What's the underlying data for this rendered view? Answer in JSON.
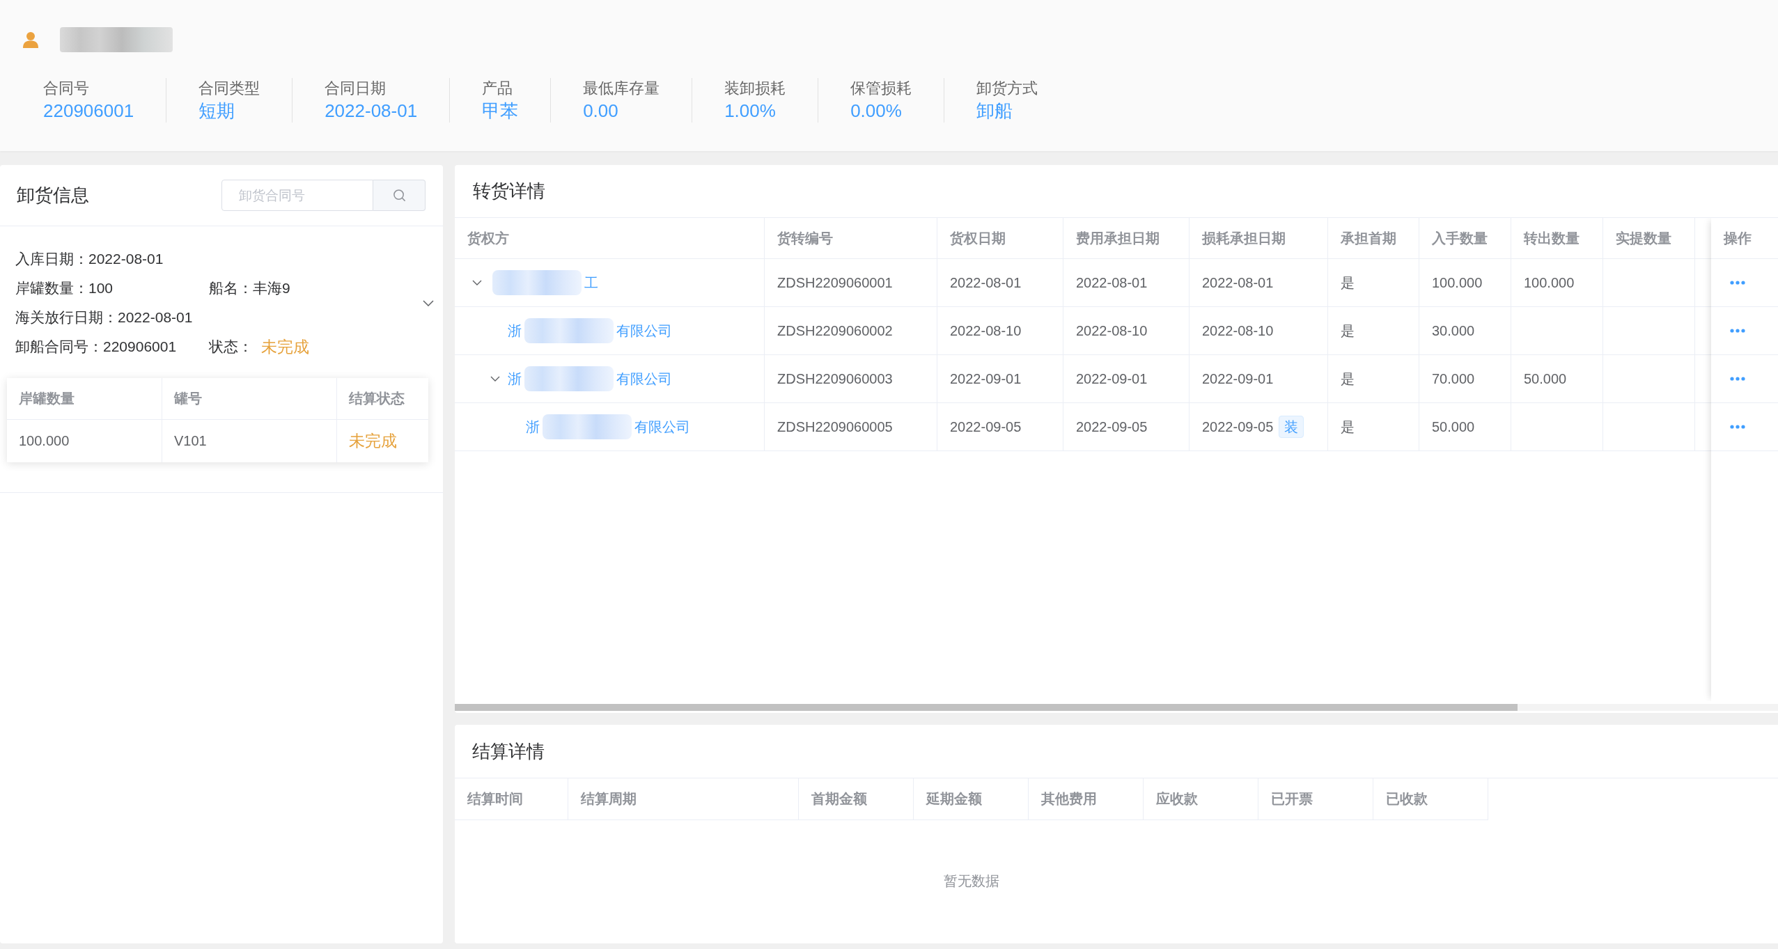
{
  "contract": {
    "fields": [
      {
        "label": "合同号",
        "value": "220906001"
      },
      {
        "label": "合同类型",
        "value": "短期"
      },
      {
        "label": "合同日期",
        "value": "2022-08-01"
      },
      {
        "label": "产品",
        "value": "甲苯"
      },
      {
        "label": "最低库存量",
        "value": "0.00"
      },
      {
        "label": "装卸损耗",
        "value": "1.00%"
      },
      {
        "label": "保管损耗",
        "value": "0.00%"
      },
      {
        "label": "卸货方式",
        "value": "卸船"
      }
    ]
  },
  "unload": {
    "title": "卸货信息",
    "search": {
      "placeholder": "卸货合同号"
    },
    "info_rows": [
      {
        "fields": [
          {
            "kind": "text",
            "label": "入库日期：",
            "value": "2022-08-01"
          }
        ]
      },
      {
        "fields": [
          {
            "kind": "text",
            "label": "岸罐数量：",
            "value": "100"
          },
          {
            "kind": "text",
            "label": "船名：",
            "value": "丰海9"
          }
        ]
      },
      {
        "fields": [
          {
            "kind": "text",
            "label": "海关放行日期：",
            "value": "2022-08-01"
          }
        ]
      },
      {
        "fields": [
          {
            "kind": "text",
            "label": "卸船合同号：",
            "value": "220906001"
          },
          {
            "kind": "status",
            "label": "状态：",
            "value": "未完成",
            "completed": false
          }
        ]
      }
    ],
    "tank_table": {
      "columns": [
        "岸罐数量",
        "罐号",
        "结算状态"
      ],
      "rows": [
        {
          "quantity": "100.000",
          "tank_no": "V101",
          "status": "未完成",
          "completed": false
        }
      ]
    }
  },
  "transfer": {
    "title": "转货详情",
    "columns": [
      "货权方",
      "货转编号",
      "货权日期",
      "费用承担日期",
      "损耗承担日期",
      "承担首期",
      "入手数量",
      "转出数量",
      "实提数量"
    ],
    "action_column": "操作",
    "rows": [
      {
        "owner_suffix": "工",
        "transfer_no": "ZDSH2209060001",
        "owner_date": "2022-08-01",
        "fee_date": "2022-08-01",
        "loss_date": "2022-08-01",
        "first_period": "是",
        "in_qty": "100.000",
        "out_qty": "100.000",
        "expanded": true,
        "children": [
          {
            "owner_prefix": "浙",
            "owner_suffix": "有限公司",
            "transfer_no": "ZDSH2209060002",
            "owner_date": "2022-08-10",
            "fee_date": "2022-08-10",
            "loss_date": "2022-08-10",
            "first_period": "是",
            "in_qty": "30.000"
          },
          {
            "owner_prefix": "浙",
            "owner_suffix": "有限公司",
            "transfer_no": "ZDSH2209060003",
            "owner_date": "2022-09-01",
            "fee_date": "2022-09-01",
            "loss_date": "2022-09-01",
            "first_period": "是",
            "in_qty": "70.000",
            "out_qty": "50.000",
            "expanded": true,
            "children": [
              {
                "owner_prefix": "浙",
                "owner_suffix": "有限公司",
                "transfer_no": "ZDSH2209060005",
                "owner_date": "2022-09-05",
                "fee_date": "2022-09-05",
                "loss_date": "2022-09-05",
                "loss_tag": "装",
                "first_period": "是",
                "in_qty": "50.000"
              }
            ]
          }
        ]
      }
    ]
  },
  "settlement": {
    "title": "结算详情",
    "columns": [
      "结算时间",
      "结算周期",
      "首期金额",
      "延期金额",
      "其他费用",
      "应收款",
      "已开票",
      "已收款"
    ],
    "empty_text": "暂无数据"
  }
}
